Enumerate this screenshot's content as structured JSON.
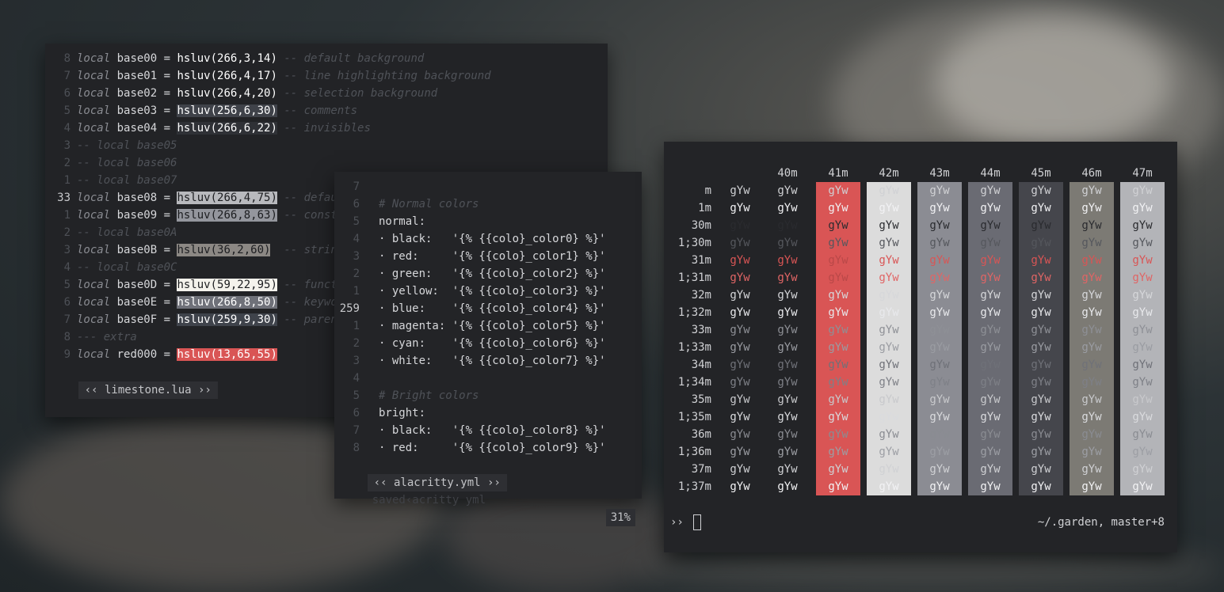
{
  "colors": {
    "win_bg": "#222326",
    "red": "#d95555",
    "gutter": "#4d5056"
  },
  "limestone": {
    "lines": [
      {
        "num": "8",
        "code": "local",
        "name": " base00 = ",
        "val": "hsluv(266,3,14)",
        "cm": " -- default background",
        "hl": "none"
      },
      {
        "num": "7",
        "code": "local",
        "name": " base01 = ",
        "val": "hsluv(266,4,17)",
        "cm": " -- line highlighting background",
        "hl": "none"
      },
      {
        "num": "6",
        "code": "local",
        "name": " base02 = ",
        "val": "hsluv(266,4,20)",
        "cm": " -- selection background",
        "hl": "none"
      },
      {
        "num": "5",
        "code": "local",
        "name": " base03 = ",
        "val": "hsluv(256,6,30)",
        "cm": " -- comments",
        "hl": "#3f4249"
      },
      {
        "num": "4",
        "code": "local",
        "name": " base04 = ",
        "val": "hsluv(266,6,22)",
        "cm": " -- invisibles",
        "hl": "#2f3136"
      },
      {
        "num": "3",
        "code": "",
        "name": "-- local base05",
        "val": "",
        "cm": "",
        "hl": "none"
      },
      {
        "num": "2",
        "code": "",
        "name": "-- local base06",
        "val": "",
        "cm": "",
        "hl": "none"
      },
      {
        "num": "1",
        "code": "",
        "name": "-- local base07",
        "val": "",
        "cm": "",
        "hl": "none"
      },
      {
        "num": "33",
        "code": "local",
        "name": " base08 = ",
        "val": "hsluv(266,4,75)",
        "cm": " -- default",
        "hl": "#b8b9bd"
      },
      {
        "num": "1",
        "code": "local",
        "name": " base09 = ",
        "val": "hsluv(266,8,63)",
        "cm": " -- constan",
        "hl": "#94969d"
      },
      {
        "num": "2",
        "code": "",
        "name": "-- local base0A",
        "val": "",
        "cm": "",
        "hl": "none"
      },
      {
        "num": "3",
        "code": "local",
        "name": " base0B = ",
        "val": "hsluv(36,2,60)",
        "cm": "  -- strings",
        "hl": "#8c8884"
      },
      {
        "num": "4",
        "code": "",
        "name": "-- local base0C",
        "val": "",
        "cm": "",
        "hl": "none"
      },
      {
        "num": "5",
        "code": "local",
        "name": " base0D = ",
        "val": "hsluv(59,22,95)",
        "cm": " -- functio",
        "hl": "#f4f2ec"
      },
      {
        "num": "6",
        "code": "local",
        "name": " base0E = ",
        "val": "hsluv(266,8,50)",
        "cm": " -- keyword",
        "hl": "#6f7179"
      },
      {
        "num": "7",
        "code": "local",
        "name": " base0F = ",
        "val": "hsluv(259,9,30)",
        "cm": " -- parens",
        "hl": "#3f434b"
      },
      {
        "num": "8",
        "code": "",
        "name": "--- extra",
        "val": "",
        "cm": "",
        "hl": "none"
      },
      {
        "num": "9",
        "code": "local",
        "name": " red000 = ",
        "val": "hsluv(13,65,55)",
        "cm": "",
        "hl": "#d95555"
      }
    ],
    "tab": "‹‹ limestone.lua ››"
  },
  "alacritty": {
    "lines": [
      {
        "num": "7",
        "text": ""
      },
      {
        "num": "6",
        "text": "# Normal colors",
        "type": "comment"
      },
      {
        "num": "5",
        "text": "normal:",
        "type": "key"
      },
      {
        "num": "4",
        "text": "· black:   '{% {{colo}_color0} %}'",
        "type": "entry"
      },
      {
        "num": "3",
        "text": "· red:     '{% {{colo}_color1} %}'",
        "type": "entry"
      },
      {
        "num": "2",
        "text": "· green:   '{% {{colo}_color2} %}'",
        "type": "entry"
      },
      {
        "num": "1",
        "text": "· yellow:  '{% {{colo}_color3} %}'",
        "type": "entry"
      },
      {
        "num": "259",
        "text": "· blue:    '{% {{colo}_color4} %}'",
        "type": "entry"
      },
      {
        "num": "1",
        "text": "· magenta: '{% {{colo}_color5} %}'",
        "type": "entry"
      },
      {
        "num": "2",
        "text": "· cyan:    '{% {{colo}_color6} %}'",
        "type": "entry"
      },
      {
        "num": "3",
        "text": "· white:   '{% {{colo}_color7} %}'",
        "type": "entry"
      },
      {
        "num": "4",
        "text": ""
      },
      {
        "num": "5",
        "text": "# Bright colors",
        "type": "comment"
      },
      {
        "num": "6",
        "text": "bright:",
        "type": "key"
      },
      {
        "num": "7",
        "text": "· black:   '{% {{colo}_color8} %}'",
        "type": "entry"
      },
      {
        "num": "8",
        "text": "· red:     '{% {{colo}_color9} %}'",
        "type": "entry"
      }
    ],
    "tab": "‹‹ alacritty.yml ››",
    "status": "saved‹acritty yml",
    "percent": "31%"
  },
  "terminal": {
    "headers": [
      "40m",
      "41m",
      "42m",
      "43m",
      "44m",
      "45m",
      "46m",
      "47m"
    ],
    "rows": [
      "m",
      "1m",
      "30m",
      "1;30m",
      "31m",
      "1;31m",
      "32m",
      "1;32m",
      "33m",
      "1;33m",
      "34m",
      "1;34m",
      "35m",
      "1;35m",
      "36m",
      "1;36m",
      "37m",
      "1;37m"
    ],
    "sample": "gYw",
    "prompt": "››",
    "cwd": "~/.garden, master+8"
  }
}
